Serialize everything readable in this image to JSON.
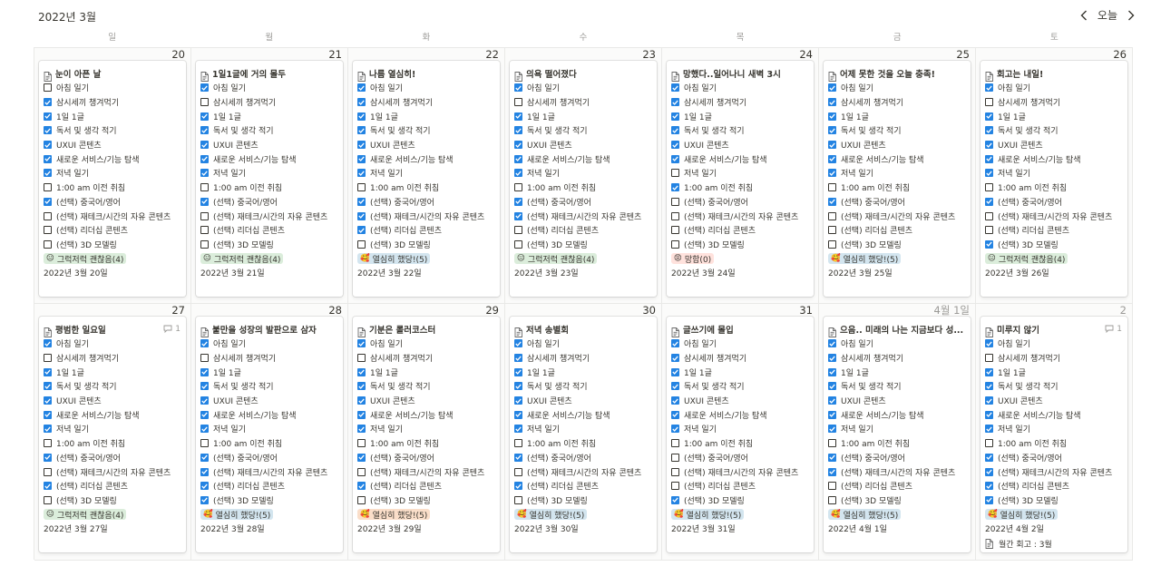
{
  "header": {
    "month_title": "2022년 3월",
    "today_label": "오늘",
    "prev_icon": "chevron-left-icon",
    "next_icon": "chevron-right-icon"
  },
  "weekdays": [
    "일",
    "월",
    "화",
    "수",
    "목",
    "금",
    "토"
  ],
  "colors": {
    "checkbox_checked": "#2383e2",
    "tag_green": "#dbeddb",
    "tag_blue": "#d3e5ef",
    "tag_red": "#ffe2dd",
    "tag_orange": "#fadec9"
  },
  "weeks": [
    {
      "days": [
        {
          "num": "20",
          "muted": false,
          "title": "눈이 아픈 날",
          "comment": "",
          "checks": [
            false,
            true,
            true,
            true,
            true,
            true,
            true,
            false,
            true,
            false,
            false,
            false
          ],
          "tag": {
            "emoji": "😐",
            "text": "그럭저럭 괜찮음(4)",
            "color": "green"
          },
          "date": "2022년 3월 20일",
          "extra": ""
        },
        {
          "num": "21",
          "muted": false,
          "title": "1일1글에 거의 몰두",
          "comment": "",
          "checks": [
            true,
            false,
            true,
            true,
            true,
            true,
            true,
            false,
            true,
            false,
            false,
            false
          ],
          "tag": {
            "emoji": "😐",
            "text": "그럭저럭 괜찮음(4)",
            "color": "green"
          },
          "date": "2022년 3월 21일",
          "extra": ""
        },
        {
          "num": "22",
          "muted": false,
          "title": "나름 열심히!",
          "comment": "",
          "checks": [
            true,
            true,
            true,
            true,
            true,
            true,
            true,
            false,
            true,
            true,
            true,
            false
          ],
          "tag": {
            "emoji": "🥰",
            "text": "열심히 했당!(5)",
            "color": "blue"
          },
          "date": "2022년 3월 22일",
          "extra": ""
        },
        {
          "num": "23",
          "muted": false,
          "title": "의욕 떨어졌다",
          "comment": "",
          "checks": [
            true,
            false,
            true,
            true,
            true,
            true,
            true,
            false,
            true,
            true,
            false,
            false
          ],
          "tag": {
            "emoji": "😐",
            "text": "그럭저럭 괜찮음(4)",
            "color": "green"
          },
          "date": "2022년 3월 23일",
          "extra": ""
        },
        {
          "num": "24",
          "muted": false,
          "title": "망했다..일어나니 새벽 3시",
          "comment": "",
          "checks": [
            true,
            true,
            true,
            true,
            true,
            true,
            false,
            true,
            false,
            false,
            false,
            false
          ],
          "tag": {
            "emoji": "😡",
            "text": "망함(0)",
            "color": "red"
          },
          "date": "2022년 3월 24일",
          "extra": ""
        },
        {
          "num": "25",
          "muted": false,
          "title": "어제 못한 것을 오늘 충족!",
          "comment": "",
          "checks": [
            true,
            true,
            true,
            true,
            true,
            true,
            true,
            false,
            true,
            false,
            false,
            false
          ],
          "tag": {
            "emoji": "🥰",
            "text": "열심히 했당!(5)",
            "color": "blue"
          },
          "date": "2022년 3월 25일",
          "extra": ""
        },
        {
          "num": "26",
          "muted": false,
          "title": "회고는 내일!",
          "comment": "",
          "checks": [
            true,
            false,
            true,
            true,
            true,
            true,
            true,
            false,
            true,
            false,
            false,
            true
          ],
          "tag": {
            "emoji": "😐",
            "text": "그럭저럭 괜찮음(4)",
            "color": "green"
          },
          "date": "2022년 3월 26일",
          "extra": ""
        }
      ]
    },
    {
      "days": [
        {
          "num": "27",
          "muted": false,
          "title": "평범한 일요일",
          "comment": "1",
          "checks": [
            true,
            false,
            true,
            true,
            true,
            true,
            true,
            false,
            true,
            false,
            true,
            false
          ],
          "tag": {
            "emoji": "😐",
            "text": "그럭저럭 괜찮음(4)",
            "color": "green"
          },
          "date": "2022년 3월 27일",
          "extra": ""
        },
        {
          "num": "28",
          "muted": false,
          "title": "불만을 성장의 발판으로 삼자",
          "comment": "",
          "checks": [
            true,
            false,
            true,
            true,
            true,
            true,
            true,
            false,
            true,
            true,
            true,
            true
          ],
          "tag": {
            "emoji": "🥰",
            "text": "열심히 했당!(5)",
            "color": "blue"
          },
          "date": "2022년 3월 28일",
          "extra": ""
        },
        {
          "num": "29",
          "muted": false,
          "title": "기분은 롤러코스터",
          "comment": "",
          "checks": [
            true,
            false,
            true,
            true,
            true,
            true,
            true,
            false,
            true,
            false,
            true,
            false
          ],
          "tag": {
            "emoji": "🥰",
            "text": "열심히 했당!(5)",
            "color": "orange"
          },
          "date": "2022년 3월 29일",
          "extra": ""
        },
        {
          "num": "30",
          "muted": false,
          "title": "저녁 송별회",
          "comment": "",
          "checks": [
            true,
            true,
            true,
            true,
            true,
            true,
            true,
            false,
            true,
            false,
            true,
            false
          ],
          "tag": {
            "emoji": "🥰",
            "text": "열심히 했당!(5)",
            "color": "blue"
          },
          "date": "2022년 3월 30일",
          "extra": ""
        },
        {
          "num": "31",
          "muted": false,
          "title": "글쓰기에 몰입",
          "comment": "",
          "checks": [
            true,
            true,
            true,
            true,
            true,
            true,
            true,
            false,
            false,
            false,
            false,
            true
          ],
          "tag": {
            "emoji": "🥰",
            "text": "열심히 했당!(5)",
            "color": "blue"
          },
          "date": "2022년 3월 31일",
          "extra": ""
        },
        {
          "num": "4월 1일",
          "muted": true,
          "title": "으음.. 미래의 나는 지금보다 성...",
          "comment": "",
          "checks": [
            true,
            true,
            true,
            true,
            true,
            true,
            true,
            false,
            true,
            true,
            false,
            false
          ],
          "tag": {
            "emoji": "🥰",
            "text": "열심히 했당!(5)",
            "color": "blue"
          },
          "date": "2022년 4월 1일",
          "extra": ""
        },
        {
          "num": "2",
          "muted": true,
          "title": "미루지 않기",
          "comment": "1",
          "checks": [
            true,
            false,
            true,
            true,
            true,
            true,
            true,
            false,
            true,
            true,
            true,
            true
          ],
          "tag": {
            "emoji": "🥰",
            "text": "열심히 했당!(5)",
            "color": "blue"
          },
          "date": "2022년 4월 2일",
          "extra": "월간 회고 : 3월"
        }
      ]
    }
  ],
  "habit_labels": [
    "아침 일기",
    "삼시세끼 챙겨먹기",
    "1일 1글",
    "독서 및 생각 적기",
    "UXUI 콘텐츠",
    "새로운 서비스/기능 탐색",
    "저녁 일기",
    "1:00 am 이전 취침",
    "(선택) 중국어/영어",
    "(선택) 재테크/시간의 자유 콘텐츠",
    "(선택) 리더십 콘텐츠",
    "(선택) 3D 모델링"
  ]
}
